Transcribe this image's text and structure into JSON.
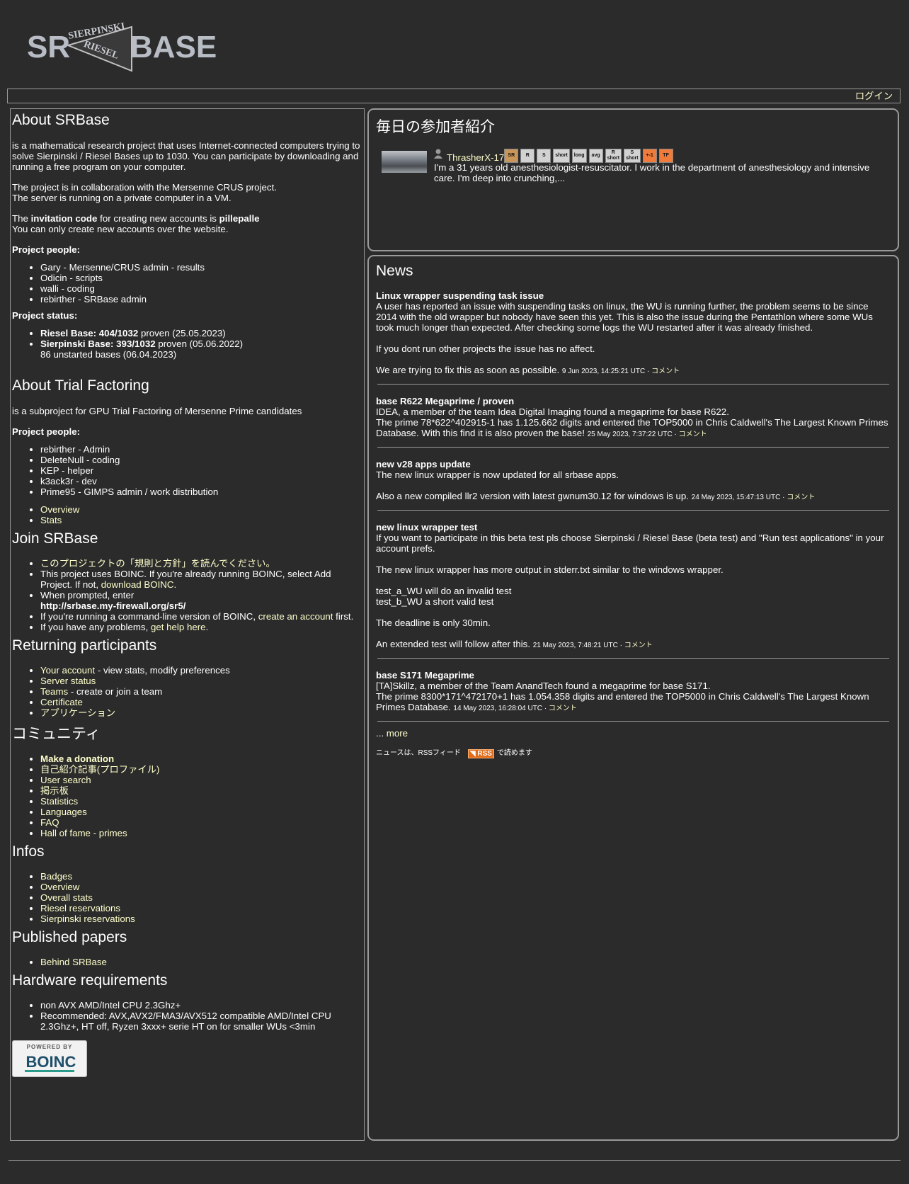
{
  "header": {
    "logo_left": "SR",
    "logo_top": "SIERPINSKI",
    "logo_mid": "RIESEL",
    "logo_right": "BASE",
    "login": "ログイン"
  },
  "about": {
    "title": "About SRBase",
    "intro": "is a mathematical research project that uses Internet-connected computers trying to solve Sierpinski / Riesel Bases up to 1030. You can participate by downloading and running a free program on your computer.",
    "collab1": "The project is in collaboration with the Mersenne CRUS project.",
    "collab2": "The server is running on a private computer in a VM.",
    "inv_pre": "The ",
    "inv_bold": "invitation code",
    "inv_mid": " for creating new accounts is ",
    "inv_code": "pillepalle",
    "inv_note": "You can only create new accounts over the website.",
    "people_title": "Project people:",
    "people": [
      "Gary - Mersenne/CRUS admin - results",
      "Odicin - scripts",
      "walli - coding",
      "rebirther - SRBase admin"
    ],
    "status_title": "Project status:",
    "riesel_bold": "Riesel Base: 404/1032",
    "riesel_rest": " proven (25.05.2023)",
    "sierp_bold": "Sierpinski Base: 393/1032",
    "sierp_rest": " proven (05.06.2022)",
    "unstarted": "86 unstarted bases (06.04.2023)"
  },
  "trial": {
    "title": "About Trial Factoring",
    "intro": "is a subproject for GPU Trial Factoring of Mersenne Prime candidates",
    "people_title": "Project people:",
    "people": [
      "rebirther - Admin",
      "DeleteNull - coding",
      "KEP - helper",
      "k3ack3r - dev",
      "Prime95 - GIMPS admin / work distribution"
    ],
    "links": [
      "Overview",
      "Stats"
    ]
  },
  "join": {
    "title": "Join SRBase",
    "rules": "このプロジェクトの「規則と方針」を読んでください。",
    "boinc_text": "This project uses BOINC. If you're already running BOINC, select Add Project. If not, ",
    "boinc_link": "download BOINC",
    "boinc_end": ".",
    "prompt_text": "When prompted, enter",
    "url": "http://srbase.my-firewall.org/sr5/",
    "cmd_text": "If you're running a command-line version of BOINC, ",
    "cmd_link": "create an account",
    "cmd_end": " first.",
    "help_text": "If you have any problems, ",
    "help_link": "get help here",
    "help_end": "."
  },
  "returning": {
    "title": "Returning participants",
    "account_link": "Your account",
    "account_rest": " - view stats, modify preferences",
    "server_status": "Server status",
    "teams_link": "Teams",
    "teams_rest": " - create or join a team",
    "certificate": "Certificate",
    "applications": "アプリケーション"
  },
  "community": {
    "title": "コミュニティ",
    "donation": "Make a donation",
    "items": [
      "自己紹介記事(プロファイル)",
      "User search",
      "掲示板",
      "Statistics",
      "Languages",
      "FAQ",
      "Hall of fame - primes"
    ]
  },
  "infos": {
    "title": "Infos",
    "items": [
      "Badges",
      "Overview",
      "Overall stats",
      "Riesel reservations",
      "Sierpinski reservations"
    ]
  },
  "papers": {
    "title": "Published papers",
    "items": [
      "Behind SRBase"
    ]
  },
  "hardware": {
    "title": "Hardware requirements",
    "items": [
      "non AVX AMD/Intel CPU 2.3Ghz+",
      "Recommended: AVX,AVX2/FMA3/AVX512 compatible AMD/Intel CPU 2.3Ghz+, HT off, Ryzen 3xxx+ serie HT on for smaller WUs <3min"
    ]
  },
  "powered": {
    "top": "POWERED BY",
    "logo": "BOINC"
  },
  "daily": {
    "title": "毎日の参加者紹介",
    "user": "ThrasherX-17",
    "badges": [
      {
        "l1": "SR",
        "l2": ""
      },
      {
        "l1": "R",
        "l2": ""
      },
      {
        "l1": "S",
        "l2": ""
      },
      {
        "l1": "short",
        "l2": ""
      },
      {
        "l1": "long",
        "l2": ""
      },
      {
        "l1": "avg",
        "l2": ""
      },
      {
        "l1": "R",
        "l2": "short"
      },
      {
        "l1": "S",
        "l2": "short"
      },
      {
        "l1": "+-1",
        "l2": ""
      },
      {
        "l1": "TF",
        "l2": ""
      }
    ],
    "text": "I'm a 31 years old anesthesiologist-resuscitator. I work in the department of anesthesiology and intensive care. I'm deep into crunching,..."
  },
  "news": {
    "title": "News",
    "items": [
      {
        "title": "Linux wrapper suspending task issue",
        "paras": [
          "A user has reported an issue with suspending tasks on linux, the WU is running further, the problem seems to be since 2014 with the old wrapper but nobody have seen this yet. This is also the issue during the Pentathlon where some WUs took much longer than expected. After checking some logs the WU restarted after it was already finished.",
          "If you dont run other projects the issue has no affect.",
          "We are trying to fix this as soon as possible."
        ],
        "date": "9 Jun 2023, 14:25:21 UTC",
        "comment": "コメント"
      },
      {
        "title": "base R622 Megaprime / proven",
        "paras": [
          "IDEA, a member of the team Idea Digital Imaging found a megaprime for base R622.\nThe prime 78*622^402915-1 has 1.125.662 digits and entered the TOP5000 in Chris Caldwell's The Largest Known Primes Database. With this find it is also proven the base!"
        ],
        "date": "25 May 2023, 7:37:22 UTC",
        "comment": "コメント"
      },
      {
        "title": "new v28 apps update",
        "paras": [
          "The new linux wrapper is now updated for all srbase apps.",
          "Also a new compiled llr2 version with latest gwnum30.12 for windows is up."
        ],
        "date": "24 May 2023, 15:47:13 UTC",
        "comment": "コメント"
      },
      {
        "title": "new linux wrapper test",
        "paras": [
          "If you want to participate in this beta test pls choose Sierpinski / Riesel Base (beta test) and \"Run test applications\" in your account prefs.",
          "The new linux wrapper has more output in stderr.txt similar to the windows wrapper.",
          "test_a_WU will do an invalid test\ntest_b_WU a short valid test",
          "The deadline is only 30min.",
          "An extended test will follow after this."
        ],
        "date": "21 May 2023, 7:48:21 UTC",
        "comment": "コメント"
      },
      {
        "title": "base S171 Megaprime",
        "paras": [
          "[TA]Skillz, a member of the Team AnandTech found a megaprime for base S171.\nThe prime 8300*171^472170+1 has 1.054.358 digits and entered the TOP5000 in Chris Caldwell's The Largest Known Primes Database."
        ],
        "date": "14 May 2023, 16:28:04 UTC",
        "comment": "コメント"
      }
    ],
    "more_prefix": "... ",
    "more_link": "more",
    "rss_pre": "ニュースは、RSSフィード",
    "rss_badge": "RSS",
    "rss_post": "で読めます"
  }
}
